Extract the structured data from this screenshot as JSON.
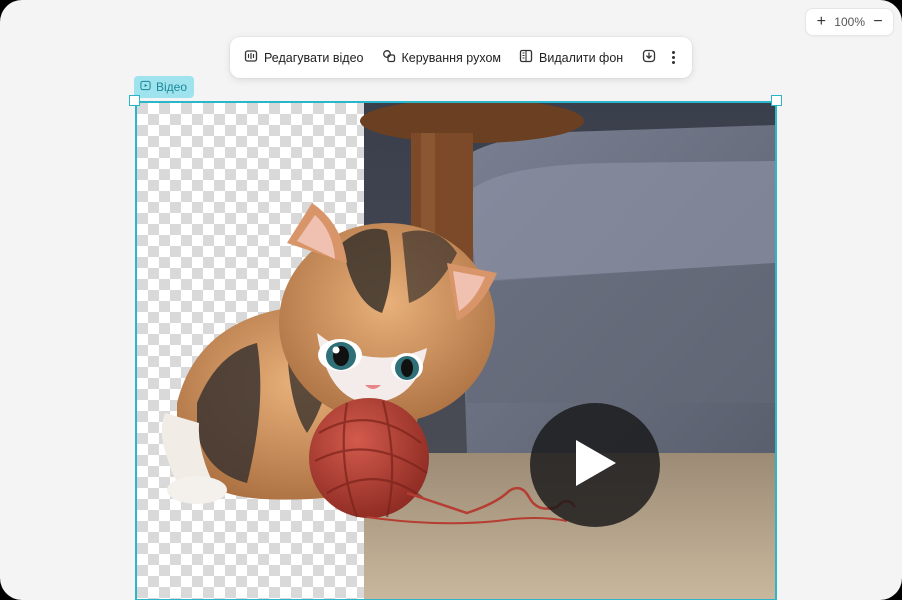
{
  "zoom": {
    "plus": "+",
    "level": "100%",
    "minus": "−"
  },
  "toolbar": {
    "edit_video": "Редагувати відео",
    "motion_control": "Керування рухом",
    "remove_bg": "Видалити фон"
  },
  "video_tag": {
    "label": "Відео"
  },
  "colors": {
    "accent": "#2ab6c8",
    "tag_bg": "#9fe3ef",
    "tag_text": "#1b8799",
    "canvas": "#f4f4f5"
  },
  "icons": [
    "video-edit-icon",
    "motion-icon",
    "remove-background-icon",
    "download-icon",
    "more-vertical-icon",
    "video-tag-icon",
    "play-icon"
  ]
}
